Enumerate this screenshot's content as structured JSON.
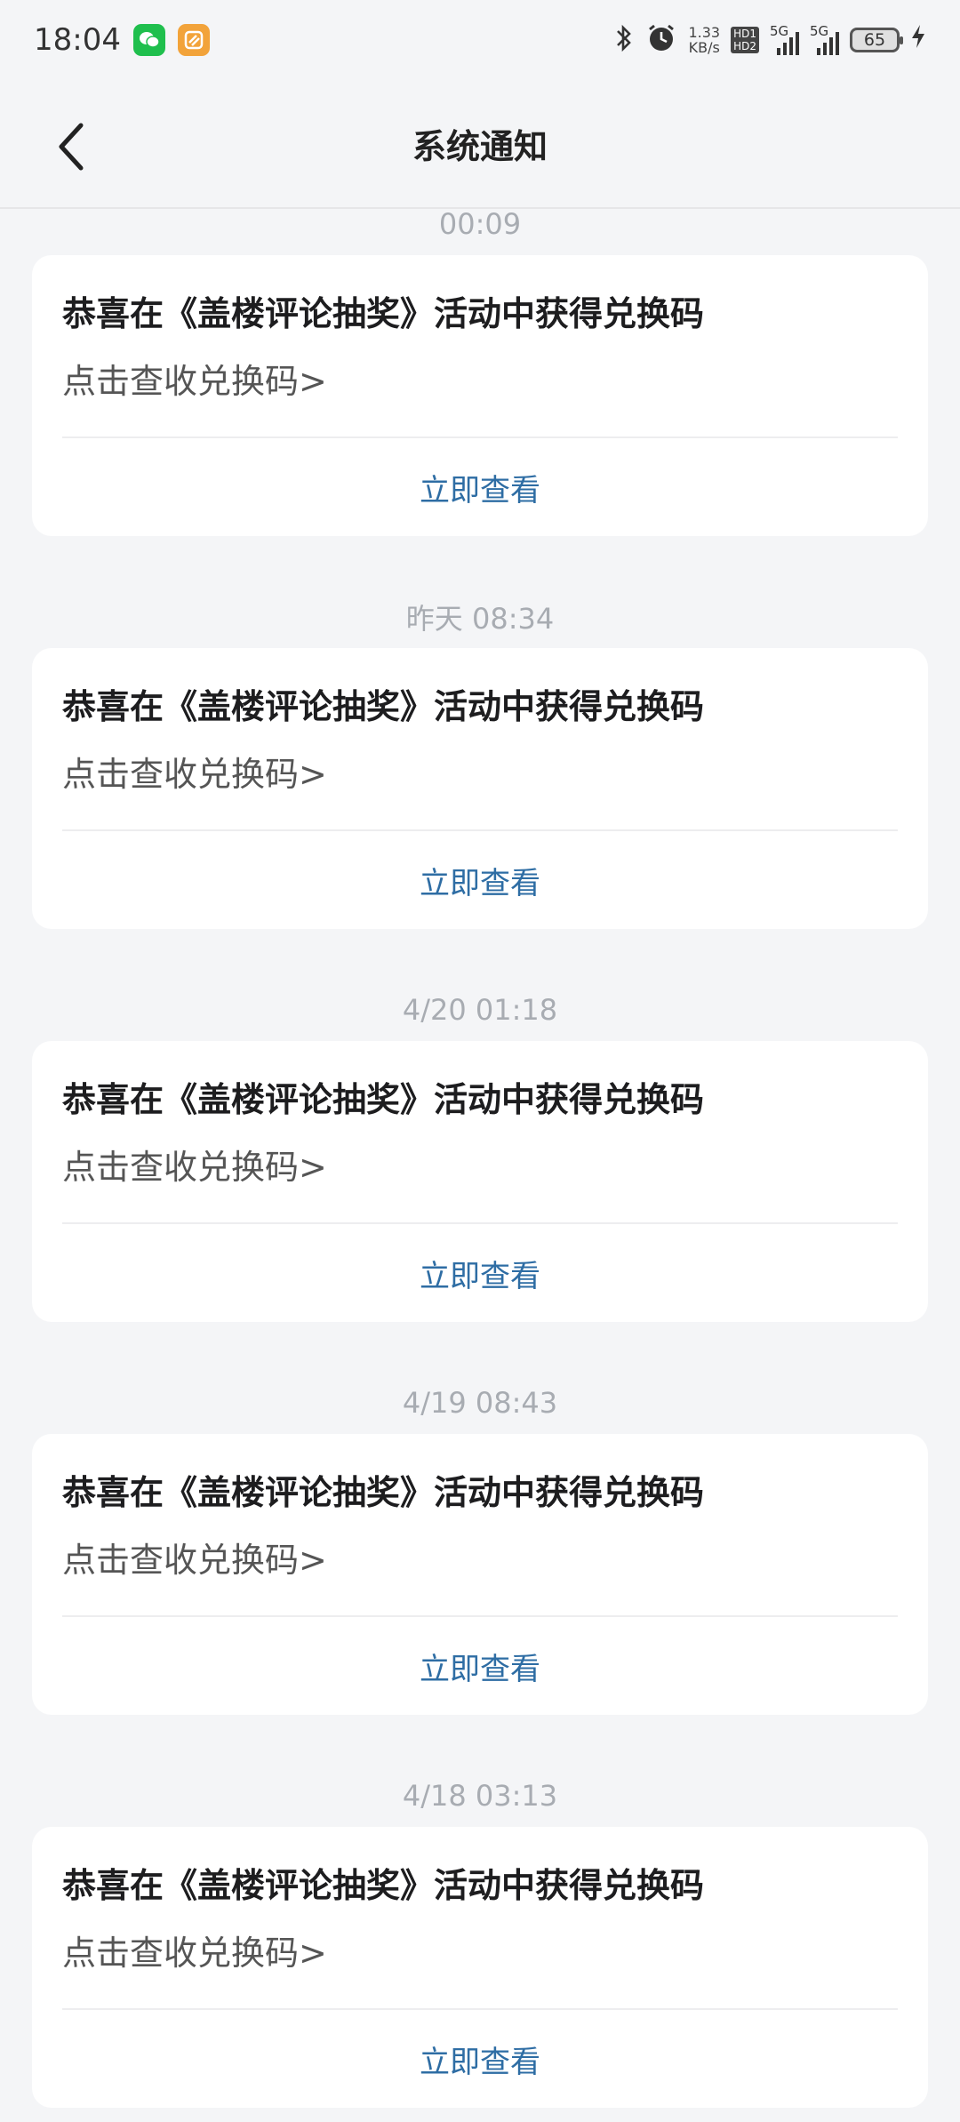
{
  "status_bar": {
    "time": "18:04",
    "net_speed_value": "1.33",
    "net_speed_unit": "KB/s",
    "hd1": "HD1",
    "hd2": "HD2",
    "sim1": "5G",
    "sim2": "5G",
    "battery": "65"
  },
  "header": {
    "title": "系统通知"
  },
  "messages": [
    {
      "time": "00:09",
      "title": "恭喜在《盖楼评论抽奖》活动中获得兑换码",
      "body": "点击查收兑换码>",
      "action": "立即查看"
    },
    {
      "time": "昨天  08:34",
      "title": "恭喜在《盖楼评论抽奖》活动中获得兑换码",
      "body": "点击查收兑换码>",
      "action": "立即查看"
    },
    {
      "time": "4/20  01:18",
      "title": "恭喜在《盖楼评论抽奖》活动中获得兑换码",
      "body": "点击查收兑换码>",
      "action": "立即查看"
    },
    {
      "time": "4/19  08:43",
      "title": "恭喜在《盖楼评论抽奖》活动中获得兑换码",
      "body": "点击查收兑换码>",
      "action": "立即查看"
    },
    {
      "time": "4/18  03:13",
      "title": "恭喜在《盖楼评论抽奖》活动中获得兑换码",
      "body": "点击查收兑换码>",
      "action": "立即查看"
    }
  ],
  "colors": {
    "background": "#f4f5f7",
    "card": "#ffffff",
    "link": "#2e6da4",
    "timestamp": "#a8acb2"
  },
  "icons": {
    "back": "chevron-left-icon",
    "bluetooth": "bluetooth-icon",
    "alarm": "alarm-icon",
    "charging": "bolt-icon"
  }
}
